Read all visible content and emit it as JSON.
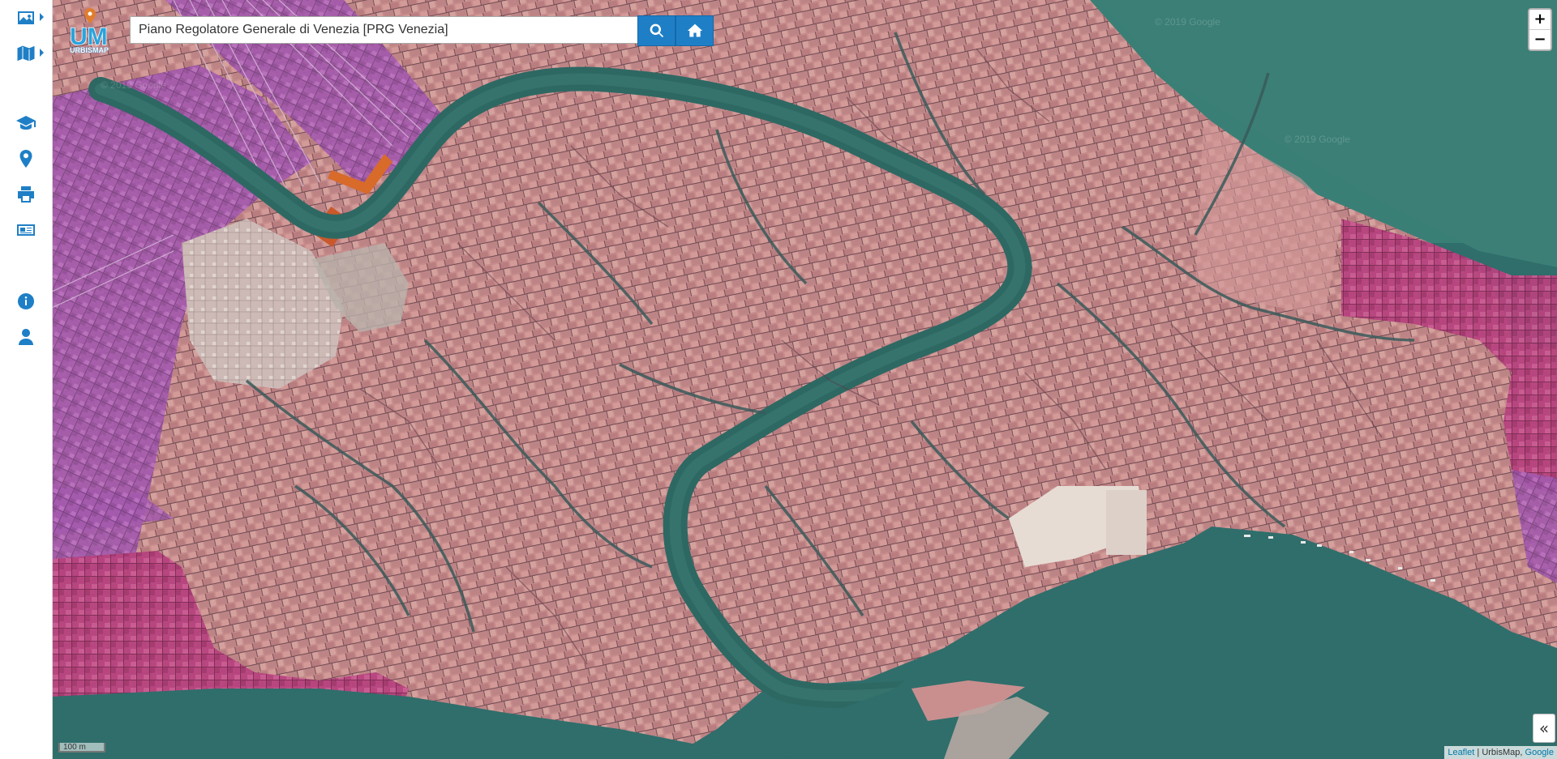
{
  "app": {
    "logo_text": "URBISMAP",
    "logo_initials": "UM"
  },
  "sidebar": {
    "items": [
      {
        "name": "image-layers-icon"
      },
      {
        "name": "map-layers-icon"
      },
      {
        "name": "graduation-cap-icon"
      },
      {
        "name": "map-marker-icon"
      },
      {
        "name": "print-icon"
      },
      {
        "name": "newspaper-icon"
      },
      {
        "name": "info-icon"
      },
      {
        "name": "user-icon"
      }
    ],
    "accent": "#1f7fc6"
  },
  "search": {
    "value": "Piano Regolatore Generale di Venezia [PRG Venezia]",
    "search_icon": "search-icon",
    "home_icon": "home-icon"
  },
  "zoom": {
    "in_label": "+",
    "out_label": "−"
  },
  "scale": {
    "label": "100 m"
  },
  "collapse": {
    "label": "«"
  },
  "attribution": {
    "leaflet": "Leaflet",
    "separator": " | UrbisMap, ",
    "google": "Google"
  },
  "map": {
    "watermark": "© 2019 Google",
    "water_color": "#2f6e6b",
    "land_color": "#c98f8f",
    "overlay_color": "#b35fb8"
  }
}
